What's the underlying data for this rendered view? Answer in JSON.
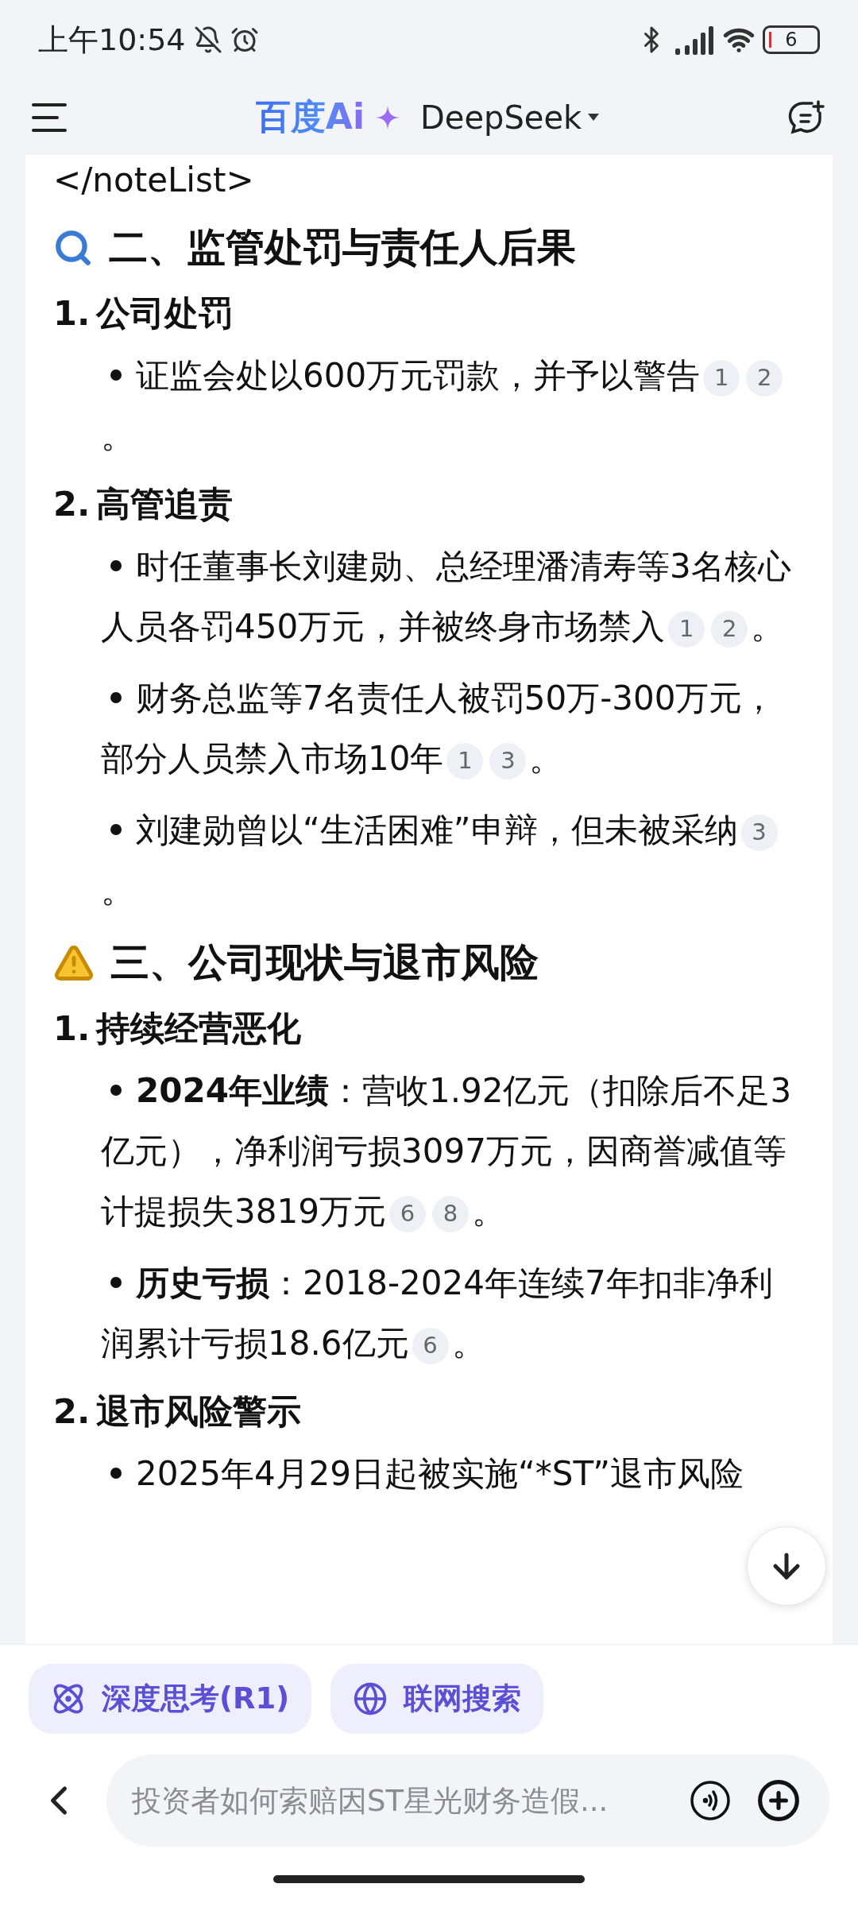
{
  "status_bar": {
    "time": "上午10:54",
    "battery": "6"
  },
  "header": {
    "logo": "百度Ai",
    "model": "DeepSeek"
  },
  "content": [
    {
      "kind": "code",
      "text": "</noteList>"
    },
    {
      "kind": "topic",
      "text": "二、监管处罚与责任人后果"
    },
    {
      "kind": "subheading",
      "number": "1.",
      "text": "公司处罚"
    },
    {
      "kind": "bullet",
      "text": "证监会处以600万元罚款，并予以警告",
      "cites": [
        "1",
        "2"
      ],
      "tail": "。"
    },
    {
      "kind": "subheading",
      "number": "2.",
      "text": "高管追责"
    },
    {
      "kind": "bullet",
      "text": "时任董事长刘建勋、总经理潘清寿等3名核心人员各罚450万元，并被终身市场禁入",
      "cites": [
        "1",
        "2"
      ],
      "tail": "。"
    },
    {
      "kind": "bullet",
      "text": "财务总监等7名责任人被罚50万-300万元，部分人员禁入市场10年",
      "cites": [
        "1",
        "3"
      ],
      "tail": "。"
    },
    {
      "kind": "bullet",
      "text": "刘建勋曾以“生活困难”申辩，但未被采纳",
      "cites": [
        "3"
      ],
      "tail": "。"
    },
    {
      "kind": "alert",
      "text": "三、公司现状与退市风险"
    },
    {
      "kind": "subheading",
      "number": "1.",
      "text": "持续经营恶化"
    },
    {
      "kind": "bullet",
      "text": "**2024年业绩**：营收1.92亿元（扣除后不足3亿元），净利润亏损3097万元，因商誉减值等计提损失3819万元",
      "cites": [
        "6",
        "8"
      ],
      "tail": "。"
    },
    {
      "kind": "bullet",
      "text": "**历史亏损**：2018-2024年连续7年扣非净利润累计亏损18.6亿元",
      "cites": [
        "6"
      ],
      "tail": "。"
    },
    {
      "kind": "subheading",
      "number": "2.",
      "text": "退市风险警示"
    },
    {
      "kind": "bullet",
      "text": "2025年4月29日起被实施“*ST”退市风险"
    }
  ],
  "chips": [
    {
      "kind": "think",
      "label": "深度思考(R1)"
    },
    {
      "kind": "web",
      "label": "联网搜索"
    }
  ],
  "input": {
    "placeholder": "投资者如何索赔因ST星光财务造假..."
  }
}
